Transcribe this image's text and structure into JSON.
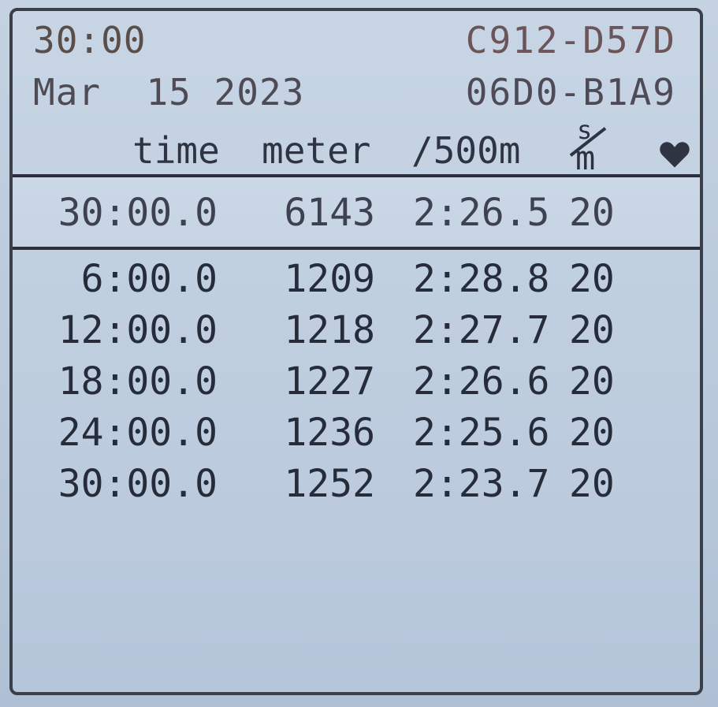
{
  "header": {
    "elapsed": "30:00",
    "date": "Mar  15 2023",
    "id_line1": "C912-D57D",
    "id_line2": "06D0-B1A9"
  },
  "columns": {
    "time": "time",
    "meter": "meter",
    "split": "/500m",
    "rate_top": "s",
    "rate_bottom": "m",
    "heart_icon": "heart-icon"
  },
  "summary": {
    "time": "30:00.0",
    "meter": "6143",
    "split": "2:26.5",
    "rate": "20"
  },
  "intervals": [
    {
      "time": "6:00.0",
      "meter": "1209",
      "split": "2:28.8",
      "rate": "20"
    },
    {
      "time": "12:00.0",
      "meter": "1218",
      "split": "2:27.7",
      "rate": "20"
    },
    {
      "time": "18:00.0",
      "meter": "1227",
      "split": "2:26.6",
      "rate": "20"
    },
    {
      "time": "24:00.0",
      "meter": "1236",
      "split": "2:25.6",
      "rate": "20"
    },
    {
      "time": "30:00.0",
      "meter": "1252",
      "split": "2:23.7",
      "rate": "20"
    }
  ],
  "colors": {
    "lcd_background": "#bfcedf",
    "lcd_text": "#262c3a",
    "frame": "#3b3f4a"
  }
}
